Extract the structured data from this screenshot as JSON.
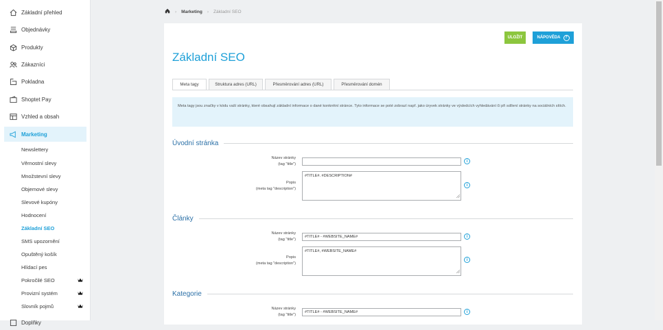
{
  "sidebar": {
    "items": [
      {
        "label": "Základní přehled",
        "icon": "home-icon"
      },
      {
        "label": "Objednávky",
        "icon": "orders-icon"
      },
      {
        "label": "Produkty",
        "icon": "box-icon"
      },
      {
        "label": "Zákazníci",
        "icon": "users-icon"
      },
      {
        "label": "Pokladna",
        "icon": "cash-register-icon"
      },
      {
        "label": "Shoptet Pay",
        "icon": "wallet-icon"
      },
      {
        "label": "Vzhled a obsah",
        "icon": "layout-icon"
      },
      {
        "label": "Marketing",
        "icon": "megaphone-icon"
      }
    ],
    "submenu": [
      {
        "label": "Newslettery"
      },
      {
        "label": "Věrnostní slevy"
      },
      {
        "label": "Množstevní slevy"
      },
      {
        "label": "Objemové slevy"
      },
      {
        "label": "Slevové kupóny"
      },
      {
        "label": "Hodnocení"
      },
      {
        "label": "Základní SEO"
      },
      {
        "label": "SMS upozornění"
      },
      {
        "label": "Opuštěný košík"
      },
      {
        "label": "Hlídací pes"
      },
      {
        "label": "Pokročilé SEO",
        "premium": true
      },
      {
        "label": "Provizní systém",
        "premium": true
      },
      {
        "label": "Slovník pojmů",
        "premium": true
      }
    ],
    "partial_item": "Doplňky"
  },
  "breadcrumb": {
    "section": "Marketing",
    "page": "Základní SEO"
  },
  "toolbar": {
    "save_label": "ULOŽIT",
    "help_label": "NÁPOVĚDA",
    "help_icon": "?"
  },
  "page": {
    "title": "Základní SEO",
    "tabs": [
      "Meta tagy",
      "Struktura adres (URL)",
      "Přesměrování adres (URL)",
      "Přesměrování domén"
    ],
    "info": "Meta tagy jsou značky v kódu vaší stránky, které obsahují základní informace o dané konkrétní stránce. Tyto informace se poté zobrazí např. jako úryvek stránky ve výsledcích vyhledávání či při sdílení stránky na sociálních sítích."
  },
  "sections": [
    {
      "heading": "Úvodní stránka",
      "title_label_1": "Název stránky",
      "title_label_2": "(tag \"title\")",
      "title_value": "",
      "desc_label_1": "Popis",
      "desc_label_2": "(meta tag \"description\")",
      "desc_value": "#TITLE#. #DESCRIPTION#"
    },
    {
      "heading": "Články",
      "title_label_1": "Název stránky",
      "title_label_2": "(tag \"title\")",
      "title_value": "#TITLE# - #WEBSITE_NAME#",
      "desc_label_1": "Popis",
      "desc_label_2": "(meta tag \"description\")",
      "desc_value": "#TITLE#, #WEBSITE_NAME#"
    },
    {
      "heading": "Kategorie",
      "title_label_1": "Název stránky",
      "title_label_2": "(tag \"title\")",
      "title_value": "#TITLE# - #WEBSITE_NAME#"
    }
  ],
  "colors": {
    "accent": "#1ea0d8",
    "save": "#8cc63e",
    "heading": "#2a6fa6"
  }
}
